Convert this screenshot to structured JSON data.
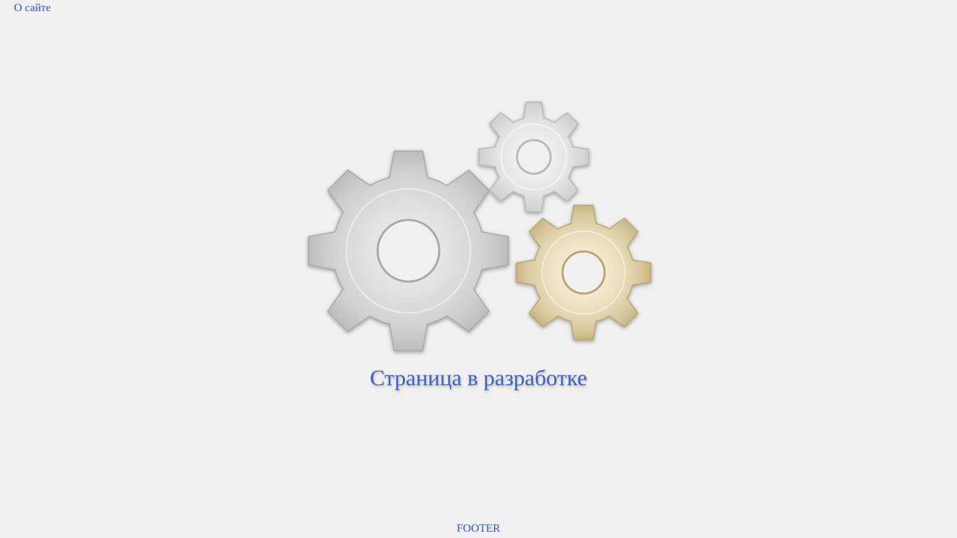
{
  "header": {
    "about_link": "О сайте"
  },
  "main": {
    "title": "Страница в разработке",
    "illustration": {
      "icon": "gears-icon",
      "gear_colors": {
        "large": "#d4d4d4",
        "small": "#e2e2e2",
        "gold": "#e6d9b8"
      }
    }
  },
  "footer": {
    "text": "FOOTER"
  }
}
